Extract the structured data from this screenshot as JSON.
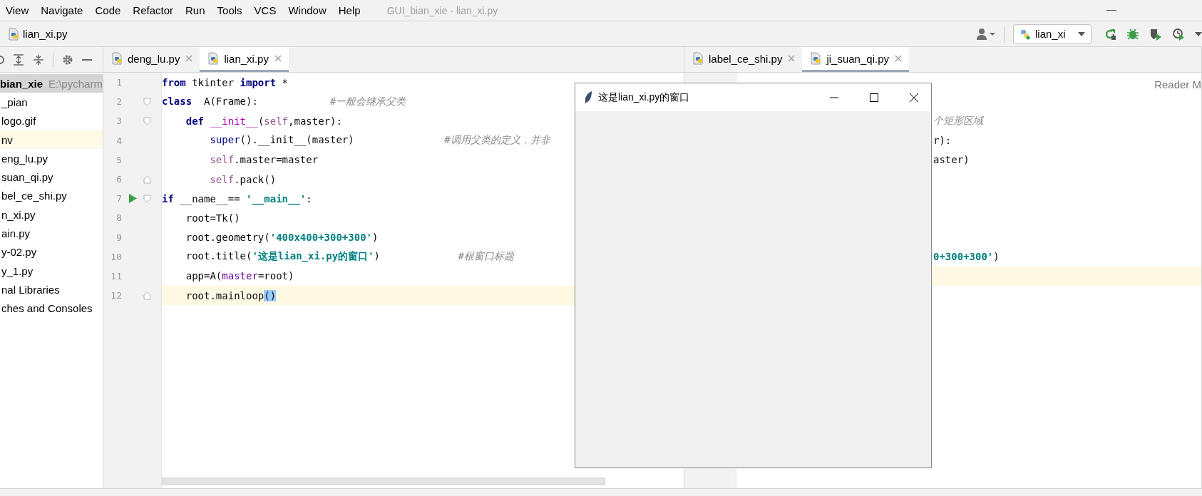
{
  "menu": [
    "View",
    "Navigate",
    "Code",
    "Refactor",
    "Run",
    "Tools",
    "VCS",
    "Window",
    "Help"
  ],
  "window_title": "GUI_bian_xie - lian_xi.py",
  "breadcrumb": "lian_xi.py",
  "run_config": "lian_xi",
  "project_tree": [
    {
      "label": "bian_xie",
      "detail": "E:\\pycharm",
      "selected": true,
      "excluded": false
    },
    {
      "label": "_pian",
      "selected": false,
      "excluded": false
    },
    {
      "label": "logo.gif",
      "selected": false,
      "excluded": false
    },
    {
      "label": "nv",
      "selected": false,
      "excluded": true
    },
    {
      "label": "eng_lu.py",
      "selected": false,
      "excluded": false
    },
    {
      "label": "suan_qi.py",
      "selected": false,
      "excluded": false
    },
    {
      "label": "bel_ce_shi.py",
      "selected": false,
      "excluded": false
    },
    {
      "label": "n_xi.py",
      "selected": false,
      "excluded": false
    },
    {
      "label": "ain.py",
      "selected": false,
      "excluded": false
    },
    {
      "label": "y-02.py",
      "selected": false,
      "excluded": false
    },
    {
      "label": "y_1.py",
      "selected": false,
      "excluded": false
    },
    {
      "label": "nal Libraries",
      "selected": false,
      "excluded": false
    },
    {
      "label": "ches and Consoles",
      "selected": false,
      "excluded": false
    }
  ],
  "editors": [
    {
      "tabs": [
        {
          "label": "deng_lu.py",
          "selected": false
        },
        {
          "label": "lian_xi.py",
          "selected": true
        }
      ],
      "lines": [
        {
          "number": "1",
          "current": false,
          "run": false,
          "fold_start": false,
          "fold_end": false,
          "tokens": [
            {
              "text": "from",
              "kind": "kw"
            },
            {
              "text": " tkinter ",
              "kind": "plain"
            },
            {
              "text": "import",
              "kind": "kw"
            },
            {
              "text": " *",
              "kind": "plain"
            }
          ]
        },
        {
          "number": "2",
          "current": false,
          "run": false,
          "fold_start": true,
          "fold_end": false,
          "tokens": [
            {
              "text": "class",
              "kind": "kw"
            },
            {
              "text": "  A(Frame):            ",
              "kind": "plain"
            },
            {
              "text": "#一般会继承父类",
              "kind": "comment"
            }
          ]
        },
        {
          "number": "3",
          "current": false,
          "run": false,
          "fold_start": true,
          "fold_end": false,
          "tokens": [
            {
              "text": "    def",
              "kind": "kw"
            },
            {
              "text": " __init__",
              "kind": "dunder"
            },
            {
              "text": "(",
              "kind": "plain"
            },
            {
              "text": "self",
              "kind": "self"
            },
            {
              "text": ",master):",
              "kind": "plain"
            }
          ]
        },
        {
          "number": "4",
          "current": false,
          "run": false,
          "fold_start": false,
          "fold_end": false,
          "tokens": [
            {
              "text": "        super",
              "kind": "builtin"
            },
            {
              "text": "().__init__(master)               ",
              "kind": "plain"
            },
            {
              "text": "#调用父类的定义，并非",
              "kind": "comment"
            }
          ]
        },
        {
          "number": "5",
          "current": false,
          "run": false,
          "fold_start": false,
          "fold_end": false,
          "tokens": [
            {
              "text": "        self",
              "kind": "self"
            },
            {
              "text": ".master=master",
              "kind": "plain"
            }
          ]
        },
        {
          "number": "6",
          "current": false,
          "run": false,
          "fold_start": false,
          "fold_end": true,
          "tokens": [
            {
              "text": "        self",
              "kind": "self"
            },
            {
              "text": ".pack()",
              "kind": "plain"
            }
          ]
        },
        {
          "number": "7",
          "current": false,
          "run": true,
          "fold_start": true,
          "fold_end": false,
          "tokens": [
            {
              "text": "if",
              "kind": "kw"
            },
            {
              "text": " __name__== ",
              "kind": "plain"
            },
            {
              "text": "'__main__'",
              "kind": "str"
            },
            {
              "text": ":",
              "kind": "plain"
            }
          ]
        },
        {
          "number": "8",
          "current": false,
          "run": false,
          "fold_start": false,
          "fold_end": false,
          "tokens": [
            {
              "text": "    root=Tk()",
              "kind": "plain"
            }
          ]
        },
        {
          "number": "9",
          "current": false,
          "run": false,
          "fold_start": false,
          "fold_end": false,
          "tokens": [
            {
              "text": "    root.geometry(",
              "kind": "plain"
            },
            {
              "text": "'400x400+300+300'",
              "kind": "str"
            },
            {
              "text": ")",
              "kind": "plain"
            }
          ]
        },
        {
          "number": "10",
          "current": false,
          "run": false,
          "fold_start": false,
          "fold_end": false,
          "tokens": [
            {
              "text": "    root.title(",
              "kind": "plain"
            },
            {
              "text": "'这是lian_xi.py的窗口'",
              "kind": "str"
            },
            {
              "text": ")             ",
              "kind": "plain"
            },
            {
              "text": "#根窗口标题",
              "kind": "comment"
            }
          ]
        },
        {
          "number": "11",
          "current": false,
          "run": false,
          "fold_start": false,
          "fold_end": false,
          "tokens": [
            {
              "text": "    app=A(",
              "kind": "plain"
            },
            {
              "text": "master",
              "kind": "param"
            },
            {
              "text": "=root)",
              "kind": "plain"
            }
          ]
        },
        {
          "number": "12",
          "current": true,
          "run": false,
          "fold_start": false,
          "fold_end": true,
          "tokens": [
            {
              "text": "    root.mainloop",
              "kind": "plain"
            },
            {
              "text": "()",
              "kind": "match"
            }
          ]
        }
      ]
    },
    {
      "tabs": [
        {
          "label": "label_ce_shi.py",
          "selected": false
        },
        {
          "label": "ji_suan_qi.py",
          "selected": true
        }
      ],
      "reader_mode": "Reader M",
      "lines": [
        {
          "current": false
        },
        {
          "current": false
        },
        {
          "current": false,
          "tokens": [
            {
              "text": "个矩形区域",
              "kind": "comment"
            }
          ]
        },
        {
          "current": false,
          "tokens": [
            {
              "text": "r):",
              "kind": "plain"
            }
          ]
        },
        {
          "current": false,
          "tokens": [
            {
              "text": "aster)",
              "kind": "plain"
            }
          ]
        },
        {
          "current": false
        },
        {
          "current": false
        },
        {
          "current": false
        },
        {
          "current": false
        },
        {
          "current": false,
          "tokens": [
            {
              "text": "0+300+300'",
              "kind": "str"
            },
            {
              "text": ")",
              "kind": "plain"
            }
          ]
        },
        {
          "current": true
        },
        {
          "current": false
        }
      ]
    }
  ],
  "tk_window": {
    "title": "这是lian_xi.py的窗口"
  }
}
